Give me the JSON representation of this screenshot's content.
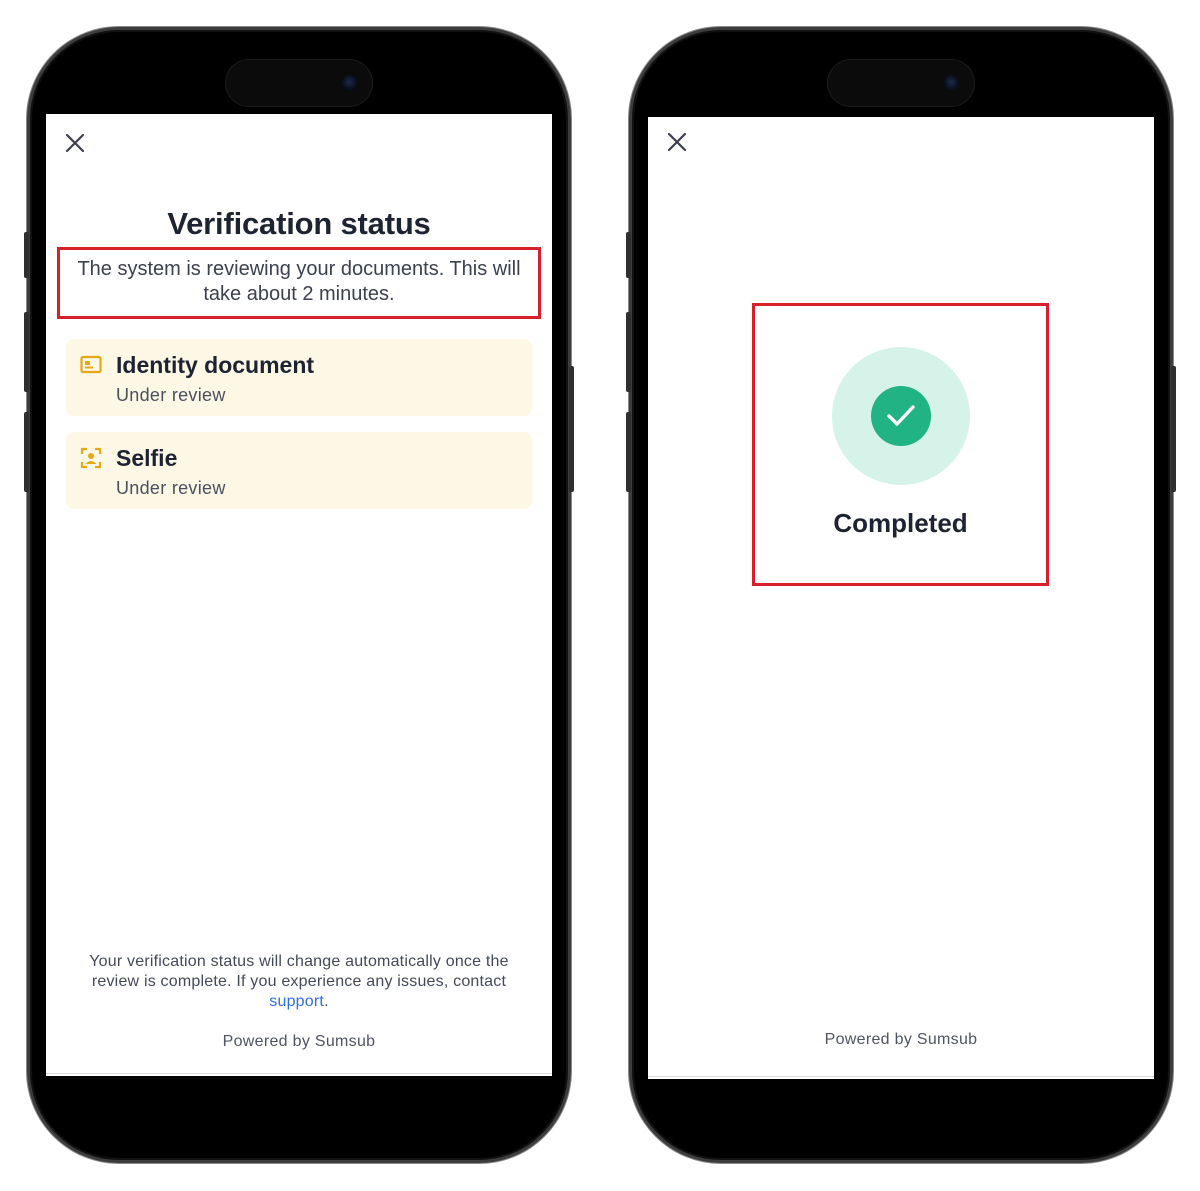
{
  "left_screen": {
    "close_icon": "close-icon",
    "title": "Verification status",
    "subtitle": "The system is reviewing your documents. This will take about 2 minutes.",
    "steps": [
      {
        "label": "Identity document",
        "status": "Under review",
        "icon": "id-card-icon"
      },
      {
        "label": "Selfie",
        "status": "Under review",
        "icon": "face-scan-icon"
      }
    ],
    "footer_note_prefix": "Your verification status will change automatically once the review is complete. If you experience any issues, contact ",
    "footer_note_link": "support",
    "footer_note_suffix": ".",
    "powered_by": "Powered by Sumsub"
  },
  "right_screen": {
    "close_icon": "close-icon",
    "status_icon": "check-circle-icon",
    "status_label": "Completed",
    "powered_by": "Powered by Sumsub"
  },
  "colors": {
    "accent_highlight": "#d8202a",
    "card_background": "#fdf7e6",
    "icon_amber": "#e7a817",
    "success_green": "#21b384",
    "success_halo": "#d6f3ea",
    "link_blue": "#2f6fe0"
  }
}
